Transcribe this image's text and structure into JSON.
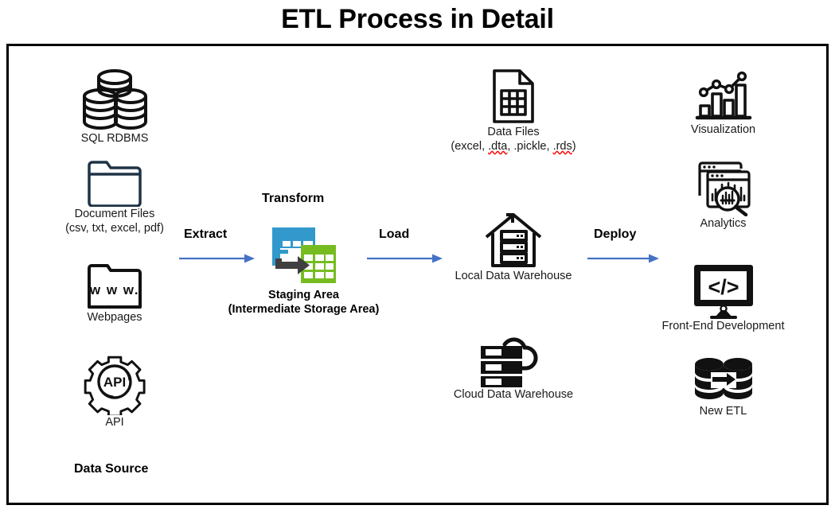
{
  "title": "ETL Process in Detail",
  "colors": {
    "arrow_blue": "#4472C4",
    "icon_black": "#111111",
    "folder_navy": "#1F3346",
    "staging_blue": "#3399CC",
    "staging_green": "#76BC21",
    "staging_arrow_gray": "#404040",
    "spell_red": "#FF0000",
    "border": "#000000"
  },
  "columns": {
    "source": {
      "heading": "Data Source"
    },
    "transform": {
      "heading": "Transform"
    }
  },
  "sources": [
    {
      "icon": "database-stack-icon",
      "label": "SQL RDBMS",
      "sublabel": ""
    },
    {
      "icon": "folder-icon",
      "label": "Document Files",
      "sublabel": "(csv, txt, excel, pdf)"
    },
    {
      "icon": "folder-www-icon",
      "label": "Webpages",
      "sublabel": "",
      "inner_text": "w w w."
    },
    {
      "icon": "api-gear-icon",
      "label": "API",
      "sublabel": "",
      "inner_text": "API"
    }
  ],
  "staging": {
    "icon": "staging-tables-icon",
    "label": "Staging Area",
    "sublabel": "(Intermediate Storage Area)"
  },
  "targets": [
    {
      "icon": "data-file-icon",
      "label": "Data Files",
      "sublabel_parts": [
        "(excel, ",
        ".dta",
        ", .pickle, ",
        ".rds",
        ")"
      ],
      "misspelled": [
        ".dta",
        ".rds"
      ]
    },
    {
      "icon": "house-server-icon",
      "label": "Local Data Warehouse",
      "sublabel": ""
    },
    {
      "icon": "cloud-server-icon",
      "label": "Cloud Data Warehouse",
      "sublabel": ""
    }
  ],
  "outputs": [
    {
      "icon": "bar-chart-line-icon",
      "label": "Visualization"
    },
    {
      "icon": "analytics-magnifier-icon",
      "label": "Analytics"
    },
    {
      "icon": "monitor-code-icon",
      "label": "Front-End Development"
    },
    {
      "icon": "etl-databases-icon",
      "label": "New ETL"
    }
  ],
  "arrows": [
    {
      "name": "extract",
      "label": "Extract"
    },
    {
      "name": "load",
      "label": "Load"
    },
    {
      "name": "deploy",
      "label": "Deploy"
    }
  ]
}
